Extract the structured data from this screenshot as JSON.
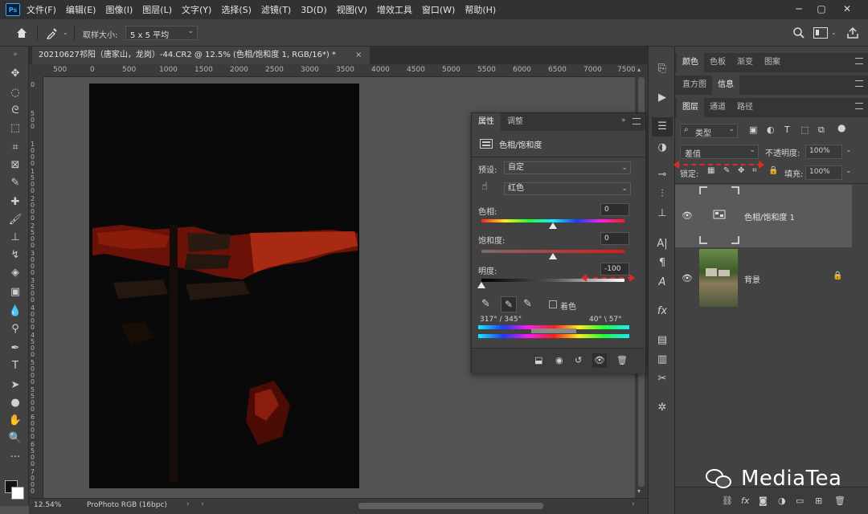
{
  "menubar": {
    "logo": "Ps",
    "items": [
      "文件(F)",
      "编辑(E)",
      "图像(I)",
      "图层(L)",
      "文字(Y)",
      "选择(S)",
      "滤镜(T)",
      "3D(D)",
      "视图(V)",
      "增效工具",
      "窗口(W)",
      "帮助(H)"
    ],
    "window_controls": [
      "─",
      "▢",
      "✕"
    ]
  },
  "optionsbar": {
    "sample_size_label": "取样大小:",
    "sample_size_value": "5 x 5 平均"
  },
  "document": {
    "tab_title": "20210627祁阳（唐家山，龙岗）-44.CR2 @ 12.5% (色相/饱和度 1, RGB/16*) *",
    "close": "×"
  },
  "ruler": {
    "h_ticks": [
      "500",
      "0",
      "500",
      "1000",
      "1500",
      "2000",
      "2500",
      "3000",
      "3500",
      "4000",
      "4500",
      "5000",
      "5500",
      "6000",
      "6500",
      "7000",
      "7500"
    ],
    "v_ticks": [
      "0",
      "500",
      "1000",
      "1500",
      "2000",
      "2500",
      "3000",
      "3500",
      "4000",
      "4500",
      "5000",
      "5500",
      "6000",
      "6500",
      "7000"
    ]
  },
  "status": {
    "zoom": "12.54%",
    "profile": "ProPhoto RGB (16bpc)"
  },
  "properties": {
    "tab_properties": "属性",
    "tab_adjustments": "调整",
    "header_title": "色相/饱和度",
    "preset_label": "预设:",
    "preset_value": "自定",
    "channel_value": "红色",
    "hue_label": "色相:",
    "hue_value": "0",
    "saturation_label": "饱和度:",
    "saturation_value": "0",
    "lightness_label": "明度:",
    "lightness_value": "-100",
    "colorize_label": "着色",
    "range_left": "317° / 345°",
    "range_right": "40° \\ 57°",
    "hue_slider_level": 0.5,
    "sat_slider_level": 0.5,
    "light_slider_level": 0.0
  },
  "right_panels": {
    "group1_tabs": [
      "颜色",
      "色板",
      "渐变",
      "图案"
    ],
    "group2_tabs": [
      "直方图",
      "信息"
    ],
    "group3_tabs": [
      "图层",
      "通道",
      "路径"
    ],
    "filter_kind": "类型",
    "blend_mode": "差值",
    "opacity_label": "不透明度:",
    "opacity_value": "100%",
    "lock_label": "锁定:",
    "fill_label": "填充:",
    "fill_value": "100%",
    "layers": [
      {
        "name": "色相/饱和度 1"
      },
      {
        "name": "背景"
      }
    ]
  },
  "watermark": {
    "text": "MediaTea"
  },
  "colors": {
    "accent_red": "#e0282a",
    "panel": "#424242",
    "dark": "#323232"
  }
}
